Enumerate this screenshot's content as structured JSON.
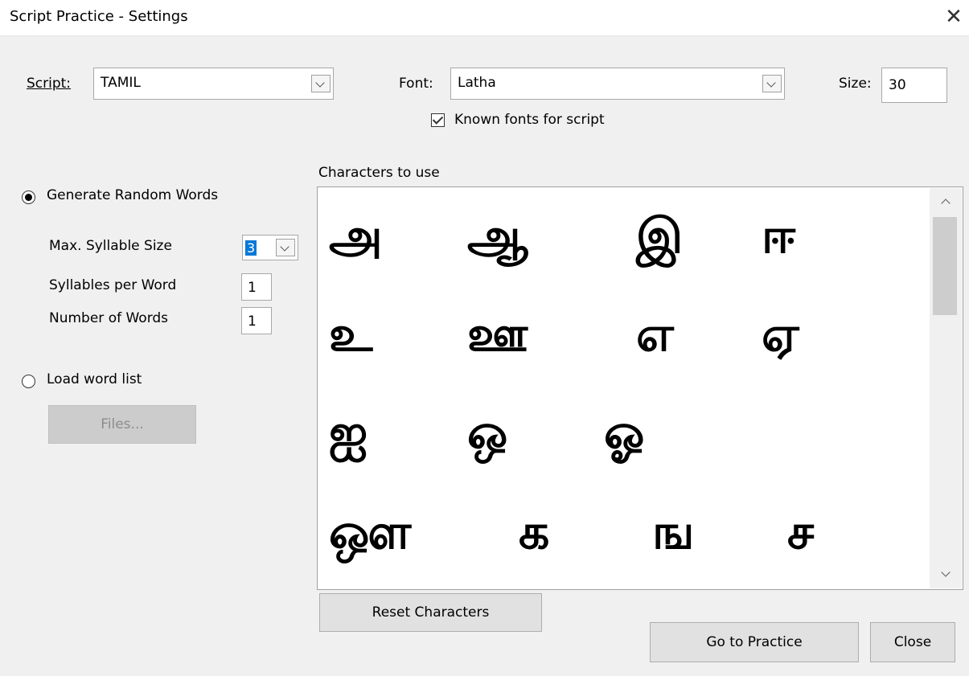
{
  "window": {
    "title": "Script Practice - Settings",
    "close_symbol": "✕"
  },
  "script": {
    "label": "Script:",
    "value": "TAMIL"
  },
  "font": {
    "label": "Font:",
    "value": "Latha",
    "known_fonts_label": "Known fonts for script",
    "known_fonts_checked": true
  },
  "size": {
    "label": "Size:",
    "value": "30"
  },
  "generate": {
    "label": "Generate Random Words",
    "selected": true,
    "max_syllable_label": "Max. Syllable Size",
    "max_syllable_value": "3",
    "syllables_per_word_label": "Syllables per Word",
    "syllables_per_word_value": "1",
    "number_of_words_label": "Number of Words",
    "number_of_words_value": "1"
  },
  "load": {
    "label": "Load word list",
    "selected": false,
    "files_button": "Files..."
  },
  "characters": {
    "label": "Characters to use",
    "rows": [
      [
        "அ",
        "ஆ",
        "இ",
        "ஈ"
      ],
      [
        "உ",
        "ஊ",
        "எ",
        "ஏ"
      ],
      [
        "ஐ",
        "ஒ",
        "ஓ"
      ],
      [
        "ஔ",
        "க",
        "ங",
        "ச"
      ]
    ]
  },
  "buttons": {
    "reset": "Reset Characters",
    "practice": "Go to Practice",
    "close": "Close"
  }
}
